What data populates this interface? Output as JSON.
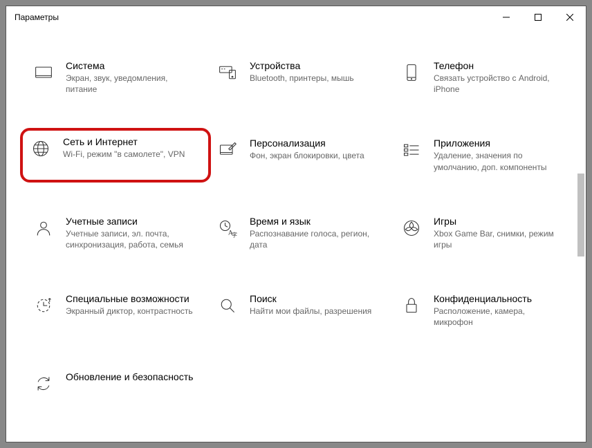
{
  "window": {
    "title": "Параметры"
  },
  "categories": [
    {
      "id": "system",
      "title": "Система",
      "desc": "Экран, звук, уведомления, питание"
    },
    {
      "id": "devices",
      "title": "Устройства",
      "desc": "Bluetooth, принтеры, мышь"
    },
    {
      "id": "phone",
      "title": "Телефон",
      "desc": "Связать устройство с Android, iPhone"
    },
    {
      "id": "network",
      "title": "Сеть и Интернет",
      "desc": "Wi-Fi, режим \"в самолете\", VPN"
    },
    {
      "id": "personalization",
      "title": "Персонализация",
      "desc": "Фон, экран блокировки, цвета"
    },
    {
      "id": "apps",
      "title": "Приложения",
      "desc": "Удаление, значения по умолчанию, доп. компоненты"
    },
    {
      "id": "accounts",
      "title": "Учетные записи",
      "desc": "Учетные записи, эл. почта, синхронизация, работа, семья"
    },
    {
      "id": "time",
      "title": "Время и язык",
      "desc": "Распознавание голоса, регион, дата"
    },
    {
      "id": "gaming",
      "title": "Игры",
      "desc": "Xbox Game Bar, снимки, режим игры"
    },
    {
      "id": "accessibility",
      "title": "Специальные возможности",
      "desc": "Экранный диктор, контрастность"
    },
    {
      "id": "search",
      "title": "Поиск",
      "desc": "Найти мои файлы, разрешения"
    },
    {
      "id": "privacy",
      "title": "Конфиденциальность",
      "desc": "Расположение, камера, микрофон"
    },
    {
      "id": "update",
      "title": "Обновление и безопасность",
      "desc": ""
    }
  ]
}
